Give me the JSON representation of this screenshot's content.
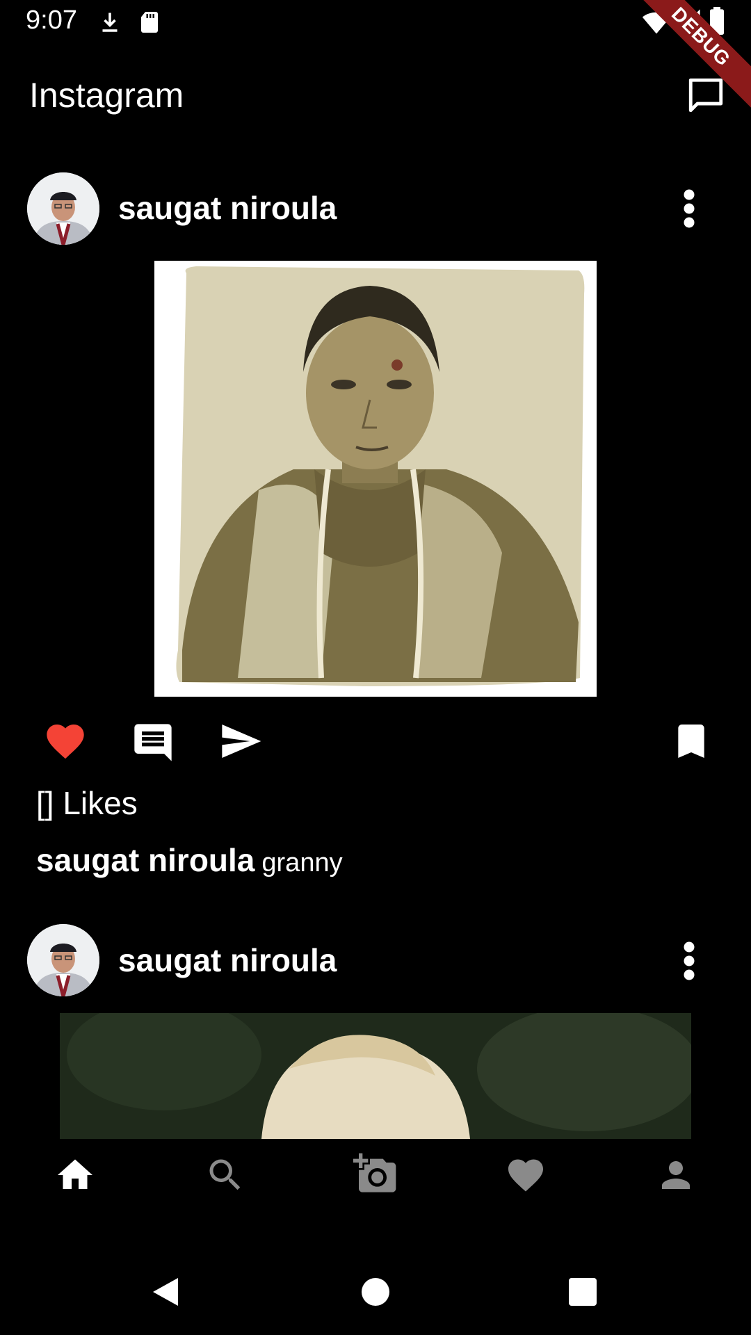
{
  "status_bar": {
    "time": "9:07",
    "icons": [
      "download-icon",
      "sd-card-icon",
      "wifi-icon",
      "signal-icon",
      "battery-icon"
    ],
    "debug_label": "DEBUG"
  },
  "app_bar": {
    "title": "Instagram",
    "action_icon": "message-icon"
  },
  "posts": [
    {
      "username": "saugat niroula",
      "likes_text": "[] Likes",
      "caption_user": "saugat niroula",
      "caption_text": "granny",
      "liked": true
    },
    {
      "username": "saugat niroula"
    }
  ],
  "bottom_nav": {
    "items": [
      "home-icon",
      "search-icon",
      "add-photo-icon",
      "heart-icon",
      "profile-icon"
    ],
    "active": "home-icon"
  },
  "colors": {
    "background": "#000000",
    "like_red": "#f44336",
    "debug_red": "#8b1a1a",
    "inactive_nav": "#8a8a8a"
  }
}
